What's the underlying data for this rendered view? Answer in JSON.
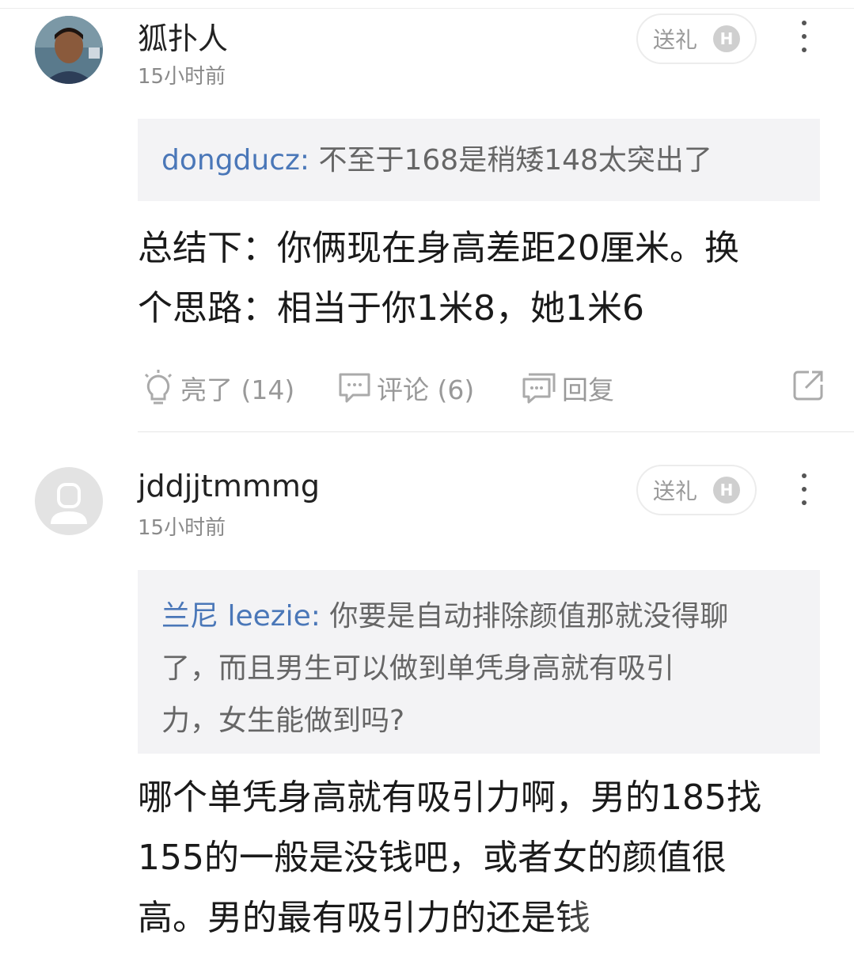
{
  "comments": [
    {
      "username": "狐扑人",
      "time": "15小时前",
      "gift_label": "送礼",
      "badge": "H",
      "quote_author": "dongducz:",
      "quote_text": " 不至于168是稍矮148太突出了",
      "body_lines": [
        "总结下：你俩现在身高差距20厘米。换",
        "个思路：相当于你1米8，她1米6"
      ],
      "actions": {
        "like": "亮了 (14)",
        "comment": "评论 (6)",
        "reply": "回复"
      },
      "icons": {
        "avatar": "photo-avatar",
        "like": "lightbulb-icon",
        "comment": "chat-bubble-icon",
        "reply": "reply-bubble-icon",
        "share": "share-icon",
        "more": "more-vertical-icon"
      }
    },
    {
      "username": "jddjjtmmmg",
      "time": "15小时前",
      "gift_label": "送礼",
      "badge": "H",
      "quote_author": "兰尼 leezie:",
      "quote_text_lines": [
        " 你要是自动排除颜值那就没得聊",
        "了，而且男生可以做到单凭身高就有吸引",
        "力，女生能做到吗?"
      ],
      "body_lines": [
        "哪个单凭身高就有吸引力啊，男的185找",
        "155的一般是没钱吧，或者女的颜值很",
        "高。男的最有吸引力的还是钱"
      ],
      "icons": {
        "avatar": "default-user-avatar",
        "more": "more-vertical-icon"
      }
    }
  ],
  "colors": {
    "link_blue": "#4a77b8",
    "muted_gray": "#999999",
    "quote_bg": "#f3f3f5"
  }
}
